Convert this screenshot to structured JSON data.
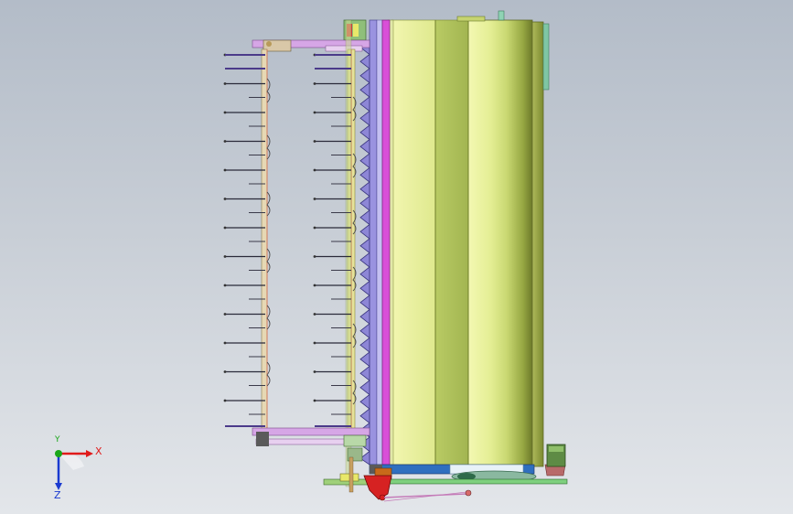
{
  "viewport": {
    "name": "cad-graphics-area",
    "colors": {
      "bg_top": "#b3bcc8",
      "bg_bottom": "#e3e6ea",
      "drum_light": "#ebf2a0",
      "drum_mid": "#bfd06a",
      "drum_dark": "#7d8c32",
      "drum_stripe": "#a9bd56",
      "auger_blue": "#8d86d6",
      "auger_dark": "#4b4791",
      "magenta_bar": "#d94fd8",
      "reel_bar": "#d6a6e6",
      "reel_frame": "#d9c8a8",
      "red_part": "#d62222",
      "green_part": "#5e8b45",
      "teal_plate": "#7fc6a4",
      "base_blue": "#2f6fbf"
    }
  },
  "triad": {
    "x_label": "X",
    "y_label": "Y",
    "z_label": "Z",
    "x_color": "#e01a1a",
    "y_color": "#1aa61a",
    "z_color": "#1a3ad0"
  }
}
